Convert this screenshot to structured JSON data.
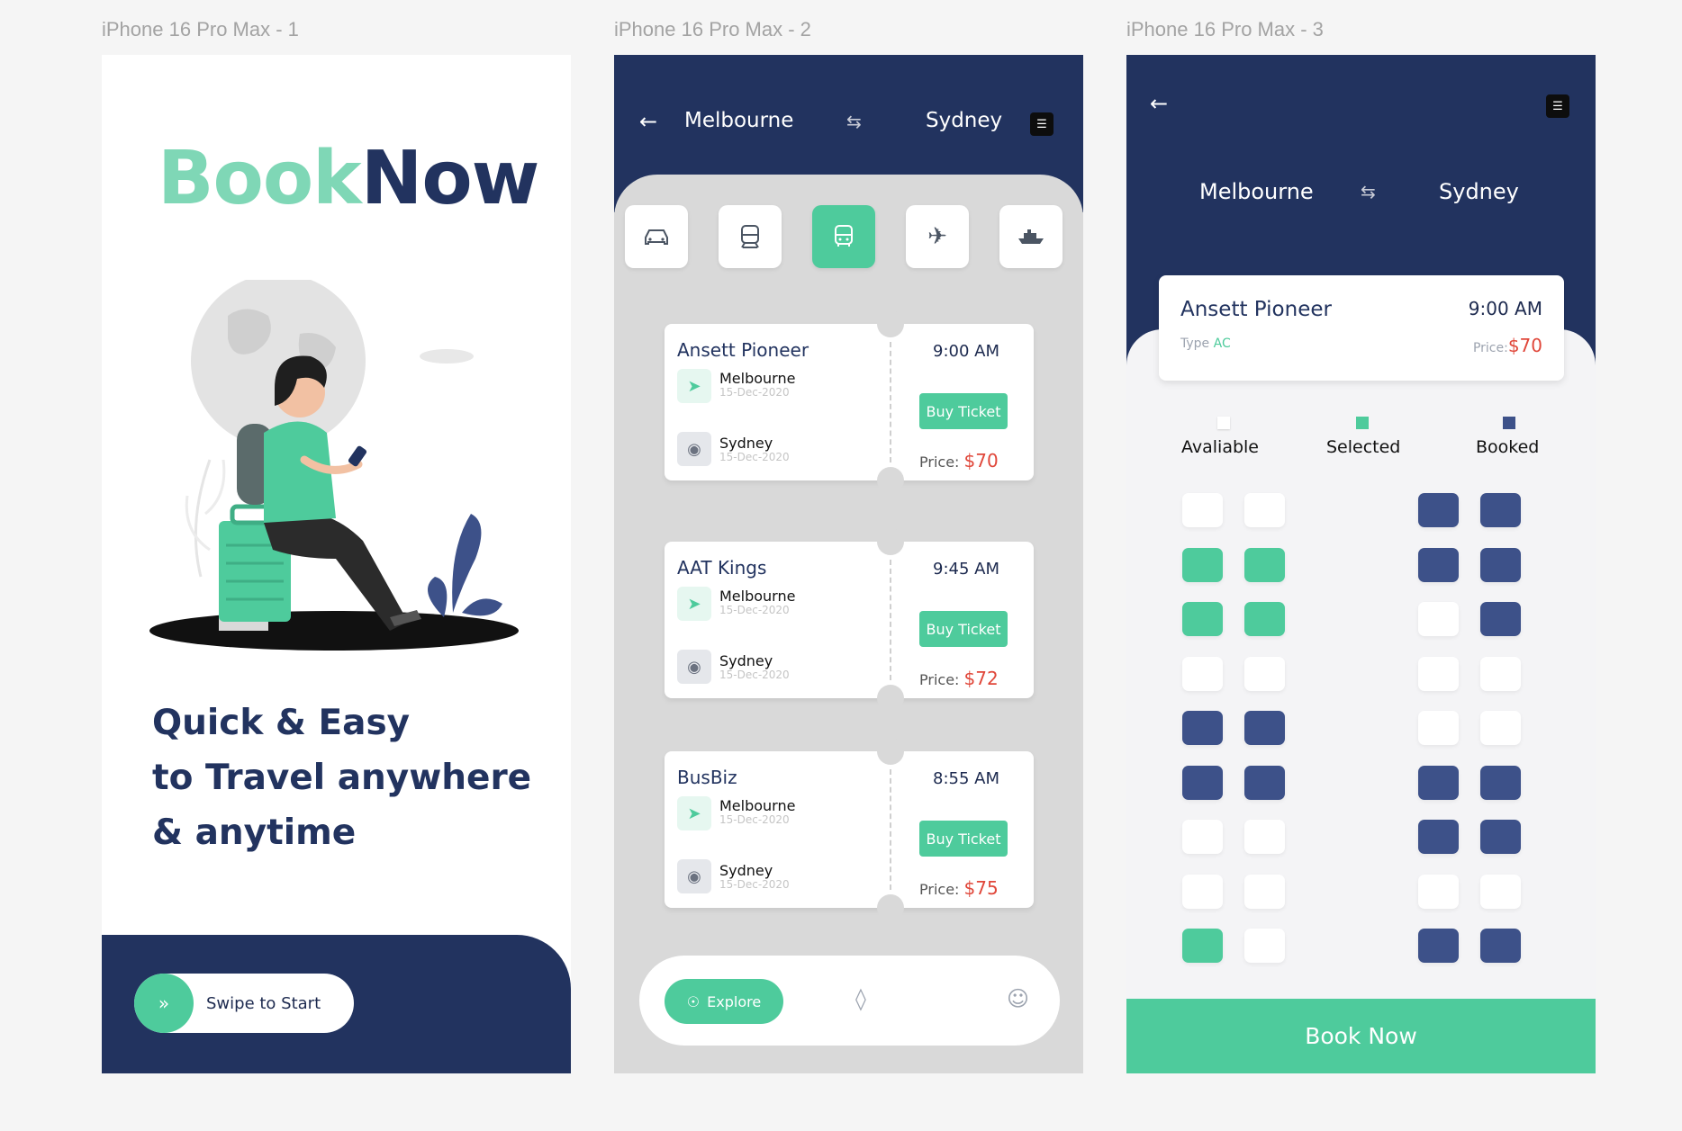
{
  "frames": {
    "s1": "iPhone 16 Pro Max - 1",
    "s2": "iPhone 16 Pro Max - 2",
    "s3": "iPhone 16 Pro Max - 3"
  },
  "colors": {
    "navy": "#22335f",
    "green": "#4ecb9c",
    "price_red": "#e0473a",
    "booked": "#3d5189"
  },
  "welcome": {
    "brand_part1": "Book",
    "brand_part2": "Now",
    "tagline_line1": "Quick & Easy",
    "tagline_line2": "to Travel anywhere",
    "tagline_line3": "& anytime",
    "swipe_label": "Swipe to Start"
  },
  "search": {
    "from": "Melbourne",
    "to": "Sydney",
    "modes": [
      {
        "icon": "car-icon",
        "active": false
      },
      {
        "icon": "train-icon",
        "active": false
      },
      {
        "icon": "bus-icon",
        "active": true
      },
      {
        "icon": "plane-icon",
        "active": false
      },
      {
        "icon": "ship-icon",
        "active": false
      }
    ],
    "tickets": [
      {
        "name": "Ansett Pioneer",
        "time": "9:00 AM",
        "from_city": "Melbourne",
        "from_date": "15-Dec-2020",
        "to_city": "Sydney",
        "to_date": "15-Dec-2020",
        "buy_label": "Buy Ticket",
        "price_label": "Price:",
        "price": "$70"
      },
      {
        "name": "AAT Kings",
        "time": "9:45 AM",
        "from_city": "Melbourne",
        "from_date": "15-Dec-2020",
        "to_city": "Sydney",
        "to_date": "15-Dec-2020",
        "buy_label": "Buy Ticket",
        "price_label": "Price:",
        "price": "$72"
      },
      {
        "name": "BusBiz",
        "time": "8:55 AM",
        "from_city": "Melbourne",
        "from_date": "15-Dec-2020",
        "to_city": "Sydney",
        "to_date": "15-Dec-2020",
        "buy_label": "Buy Ticket",
        "price_label": "Price:",
        "price": "$75"
      }
    ],
    "nav": {
      "explore_label": "Explore"
    }
  },
  "seats": {
    "from": "Melbourne",
    "to": "Sydney",
    "card": {
      "name": "Ansett Pioneer",
      "time": "9:00 AM",
      "type_label": "Type",
      "type_value": "AC",
      "price_label": "Price:",
      "price": "$70"
    },
    "legend": {
      "available": "Avaliable",
      "selected": "Selected",
      "booked": "Booked"
    },
    "grid": [
      [
        "a",
        "a",
        "b",
        "b"
      ],
      [
        "s",
        "s",
        "b",
        "b"
      ],
      [
        "s",
        "s",
        "a",
        "b"
      ],
      [
        "a",
        "a",
        "a",
        "a"
      ],
      [
        "b",
        "b",
        "a",
        "a"
      ],
      [
        "b",
        "b",
        "b",
        "b"
      ],
      [
        "a",
        "a",
        "b",
        "b"
      ],
      [
        "a",
        "a",
        "a",
        "a"
      ],
      [
        "s",
        "a",
        "b",
        "b"
      ]
    ],
    "book_label": "Book Now"
  }
}
